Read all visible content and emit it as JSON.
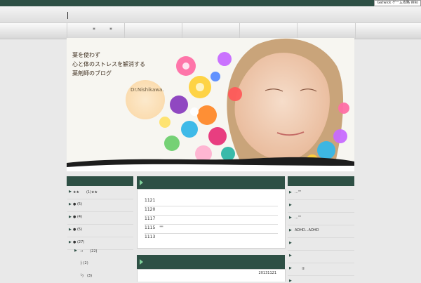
{
  "header": {
    "badge": "Gatwick ゲーム攻略 Wiki",
    "nav_stars": [
      "*",
      "*"
    ]
  },
  "hero": {
    "lines": [
      "薬を使わず",
      "心と体のストレスを解消する",
      "薬剤師のブログ"
    ],
    "signature": "Dr.Nishikawa."
  },
  "left_sidebar": {
    "items": [
      {
        "text": "★★　　(1)★★"
      },
      {
        "text": "● (5)"
      },
      {
        "text": "● (4)"
      },
      {
        "text": "● (5)"
      },
      {
        "text": "● (27)"
      },
      {
        "text": "→　　(22)"
      },
      {
        "text": "├ (2)"
      },
      {
        "text": "└)　(3)"
      }
    ]
  },
  "center": {
    "posts": [
      "1121",
      "1120",
      "1117",
      "1115　\"\"",
      "1113"
    ],
    "post_date": "20131121"
  },
  "right_sidebar": {
    "items": [
      {
        "text": "...\"\""
      },
      {
        "text": ""
      },
      {
        "text": "...\"\""
      },
      {
        "text": "ADHD...ADHD"
      },
      {
        "text": ""
      },
      {
        "text": ""
      },
      {
        "text": "　　②"
      },
      {
        "text": ""
      }
    ]
  },
  "colors": {
    "accent": "#2e5045",
    "arrow": "#7fd09a"
  }
}
